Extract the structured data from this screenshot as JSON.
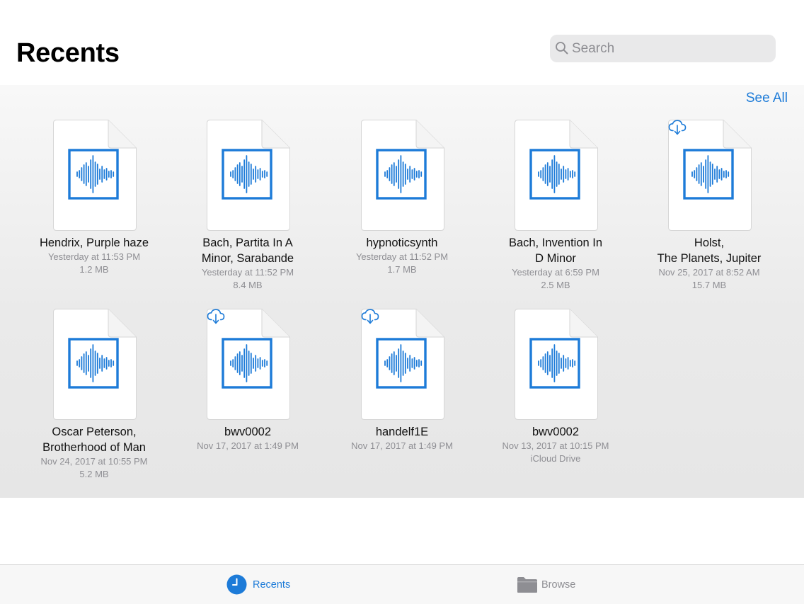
{
  "header": {
    "title": "Recents"
  },
  "search": {
    "placeholder": "Search"
  },
  "section": {
    "see_all_label": "See All"
  },
  "colors": {
    "accent": "#1d7bd8",
    "secondary_text": "#8e8e93"
  },
  "files": [
    {
      "name": "Hendrix, Purple haze",
      "date": "Yesterday at 11:53 PM",
      "detail": "1.2 MB",
      "icon": "audio-waveform-icon",
      "cloud_download": false
    },
    {
      "name": "Bach, Partita In A Minor, Sarabande",
      "date": "Yesterday at 11:52 PM",
      "detail": "8.4 MB",
      "icon": "audio-waveform-icon",
      "cloud_download": false
    },
    {
      "name": "hypnoticsynth",
      "date": "Yesterday at 11:52 PM",
      "detail": "1.7 MB",
      "icon": "audio-waveform-icon",
      "cloud_download": false
    },
    {
      "name": "Bach, Invention In D Minor",
      "date": "Yesterday at 6:59 PM",
      "detail": "2.5 MB",
      "icon": "audio-waveform-icon",
      "cloud_download": false
    },
    {
      "name": "Holst, The Planets, Jupiter",
      "date": "Nov 25, 2017 at 8:52 AM",
      "detail": "15.7 MB",
      "icon": "audio-waveform-icon",
      "cloud_download": true
    },
    {
      "name": "Oscar Peterson, Brotherhood of Man",
      "date": "Nov 24, 2017 at 10:55 PM",
      "detail": "5.2 MB",
      "icon": "audio-waveform-icon",
      "cloud_download": false
    },
    {
      "name": "bwv0002",
      "date": "Nov 17, 2017 at 1:49 PM",
      "detail": "",
      "icon": "audio-waveform-icon",
      "cloud_download": true
    },
    {
      "name": "handelf1E",
      "date": "Nov 17, 2017 at 1:49 PM",
      "detail": "",
      "icon": "audio-waveform-icon",
      "cloud_download": true
    },
    {
      "name": "bwv0002",
      "date": "Nov 13, 2017 at 10:15 PM",
      "detail": "iCloud Drive",
      "icon": "audio-waveform-icon",
      "cloud_download": false
    }
  ],
  "tabs": [
    {
      "label": "Recents",
      "icon": "clock-icon",
      "active": true
    },
    {
      "label": "Browse",
      "icon": "folder-icon",
      "active": false
    }
  ]
}
